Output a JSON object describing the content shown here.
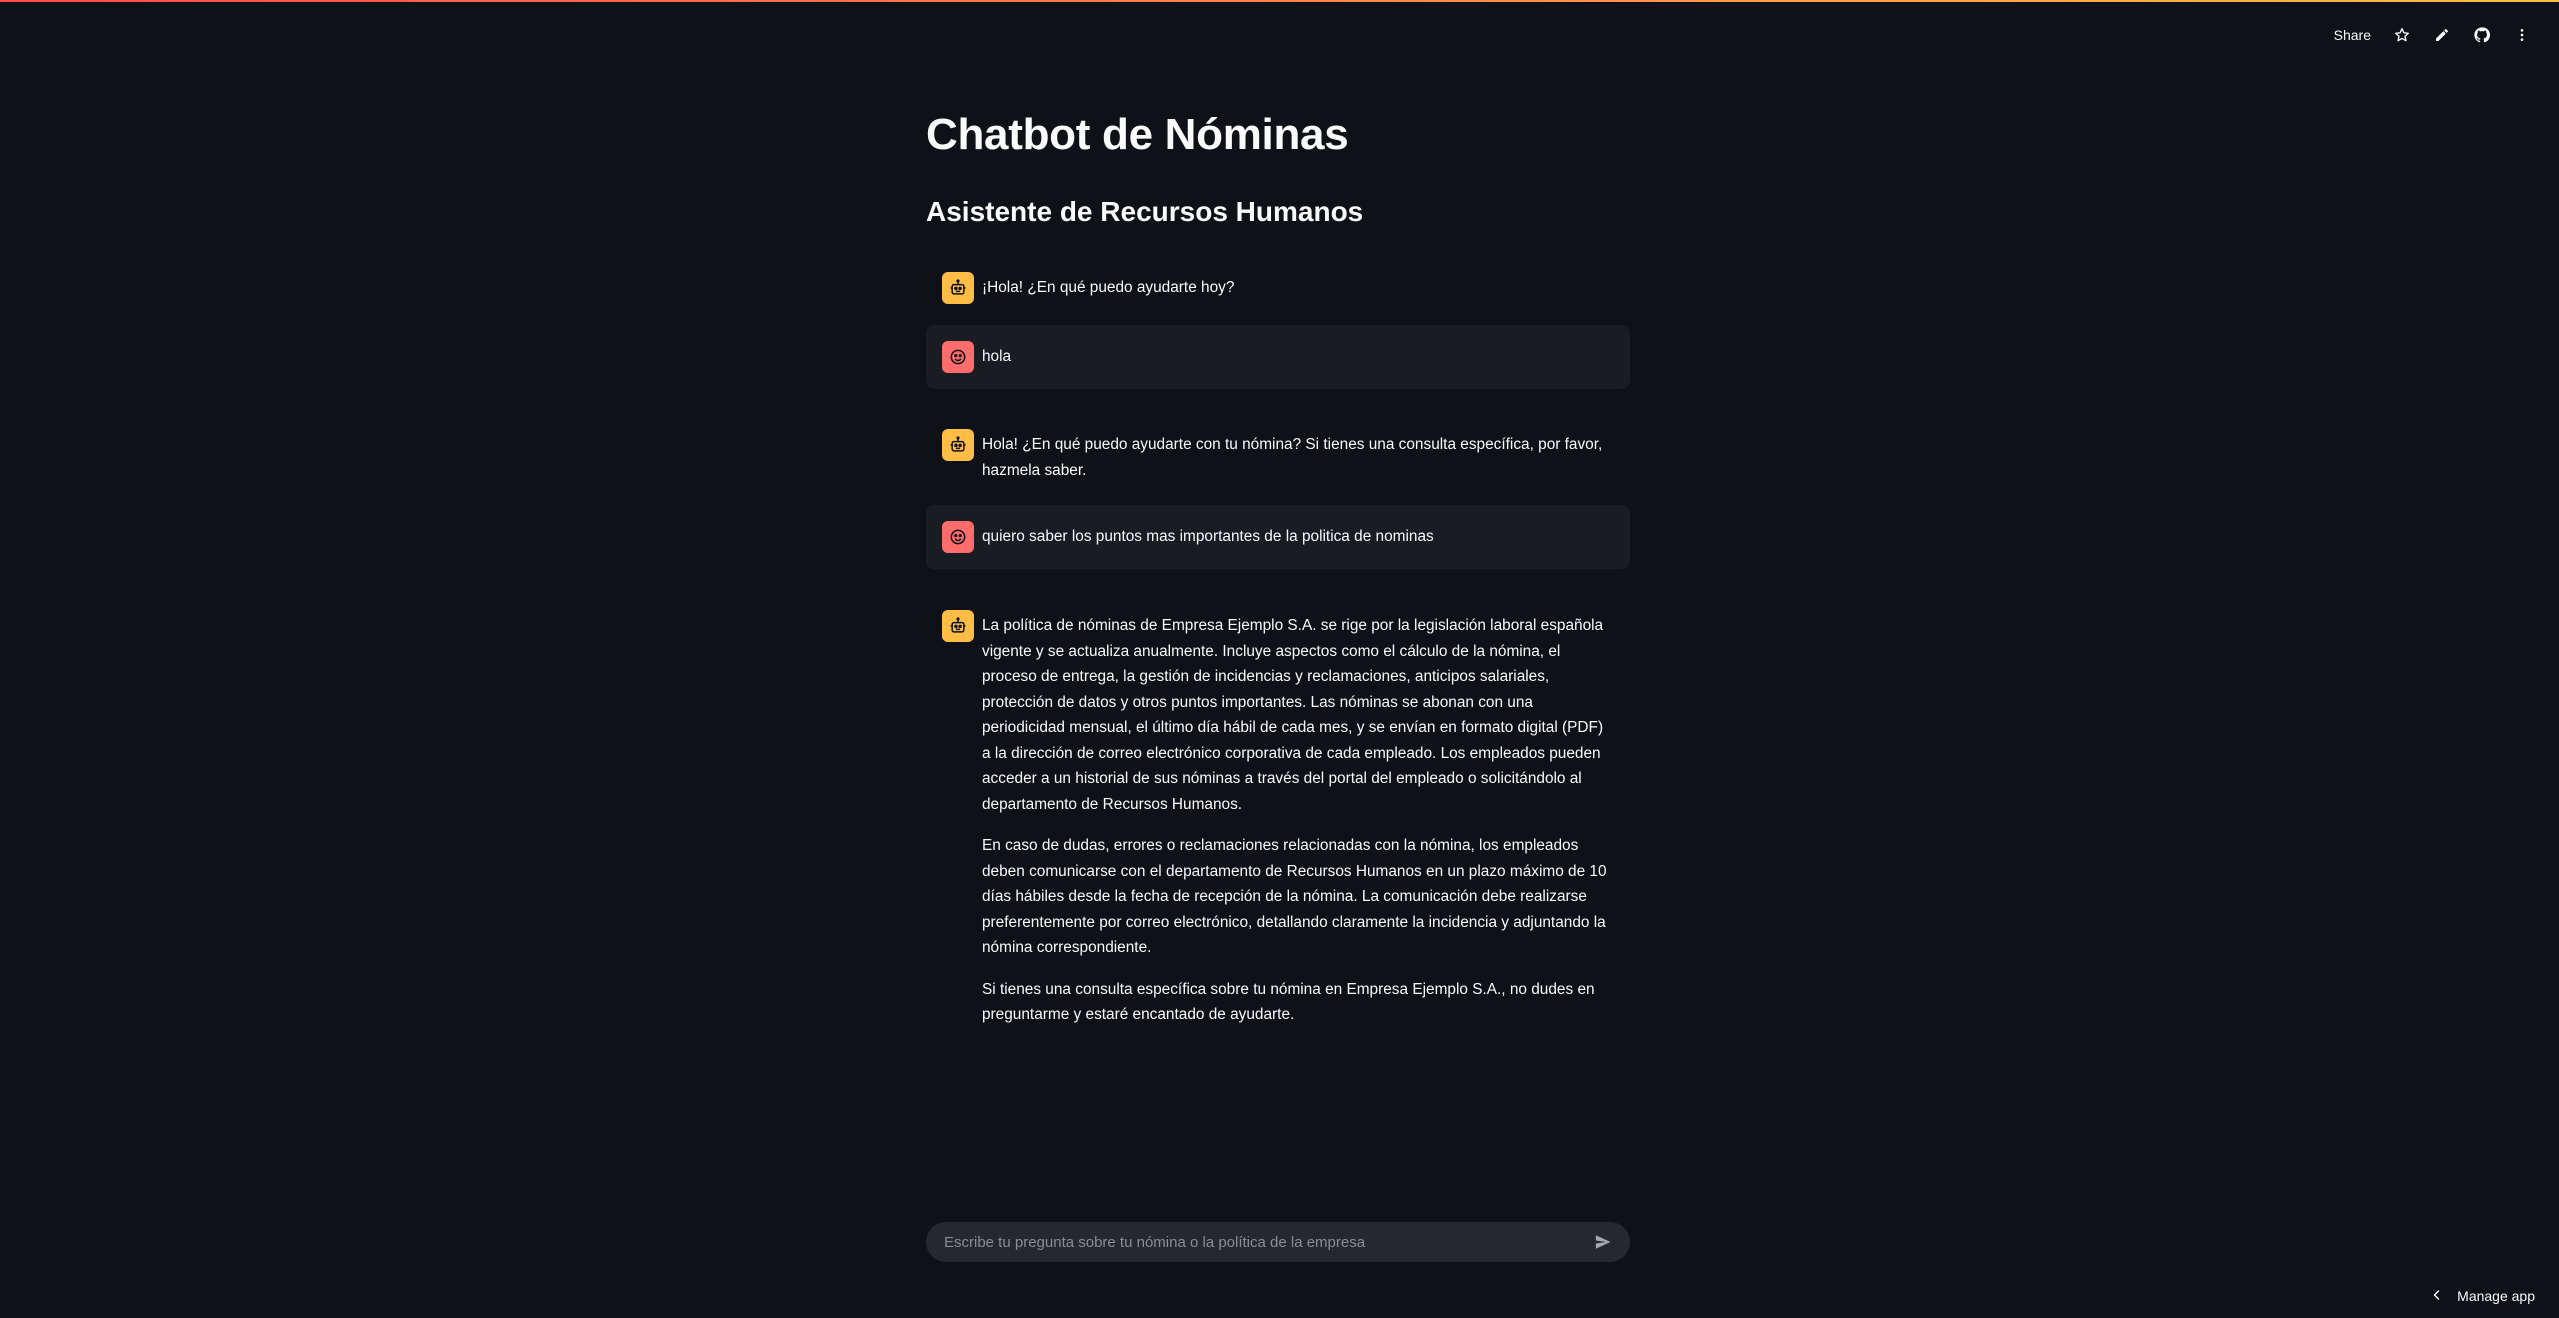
{
  "toolbar": {
    "share_label": "Share",
    "icons": [
      "star-icon",
      "pencil-icon",
      "github-icon",
      "more-vertical-icon"
    ]
  },
  "page": {
    "title": "Chatbot de Nóminas",
    "subtitle": "Asistente de Recursos Humanos"
  },
  "messages": [
    {
      "role": "assistant",
      "avatar_icon": "robot-icon",
      "paragraphs": [
        "¡Hola! ¿En qué puedo ayudarte hoy?"
      ]
    },
    {
      "role": "user",
      "avatar_icon": "smiley-icon",
      "paragraphs": [
        "hola"
      ]
    },
    {
      "role": "assistant",
      "avatar_icon": "robot-icon",
      "paragraphs": [
        "Hola! ¿En qué puedo ayudarte con tu nómina? Si tienes una consulta específica, por favor, hazmela saber."
      ]
    },
    {
      "role": "user",
      "avatar_icon": "smiley-icon",
      "paragraphs": [
        "quiero saber los puntos mas importantes de la politica de nominas"
      ]
    },
    {
      "role": "assistant",
      "avatar_icon": "robot-icon",
      "paragraphs": [
        "La política de nóminas de Empresa Ejemplo S.A. se rige por la legislación laboral española vigente y se actualiza anualmente. Incluye aspectos como el cálculo de la nómina, el proceso de entrega, la gestión de incidencias y reclamaciones, anticipos salariales, protección de datos y otros puntos importantes. Las nóminas se abonan con una periodicidad mensual, el último día hábil de cada mes, y se envían en formato digital (PDF) a la dirección de correo electrónico corporativa de cada empleado. Los empleados pueden acceder a un historial de sus nóminas a través del portal del empleado o solicitándolo al departamento de Recursos Humanos.",
        "En caso de dudas, errores o reclamaciones relacionadas con la nómina, los empleados deben comunicarse con el departamento de Recursos Humanos en un plazo máximo de 10 días hábiles desde la fecha de recepción de la nómina. La comunicación debe realizarse preferentemente por correo electrónico, detallando claramente la incidencia y adjuntando la nómina correspondiente.",
        "Si tienes una consulta específica sobre tu nómina en Empresa Ejemplo S.A., no dudes en preguntarme y estaré encantado de ayudarte."
      ]
    }
  ],
  "chat_input": {
    "placeholder": "Escribe tu pregunta sobre tu nómina o la política de la empresa",
    "value": "",
    "send_icon": "send-icon"
  },
  "footer": {
    "manage_label": "Manage app",
    "icon": "chevron-left-icon"
  },
  "colors": {
    "background": "#0e1117",
    "user_bubble": "#1a1c24",
    "bot_avatar": "#ffbd45",
    "user_avatar": "#ff6c6c",
    "input_bg": "#262730"
  }
}
